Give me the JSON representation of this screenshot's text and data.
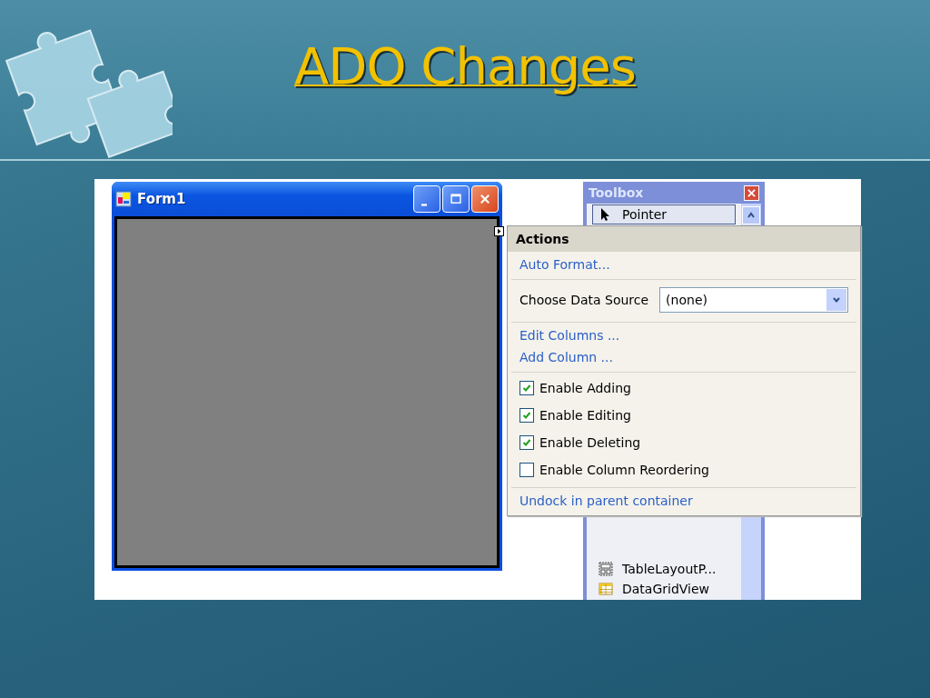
{
  "slide": {
    "title": "ADO Changes"
  },
  "form_window": {
    "title": "Form1"
  },
  "toolbox": {
    "title": "Toolbox",
    "items": [
      {
        "label": "Pointer",
        "kind": "pointer",
        "selected": true
      },
      {
        "label": "TableLayoutP...",
        "kind": "table-layout",
        "selected": false
      },
      {
        "label": "DataGridView",
        "kind": "grid",
        "selected": false
      }
    ]
  },
  "actions_panel": {
    "title": "Actions",
    "sections": [
      [
        {
          "kind": "link",
          "label": "Auto Format..."
        }
      ],
      [
        {
          "kind": "dropdown",
          "label": "Choose Data Source",
          "value": "(none)"
        }
      ],
      [
        {
          "kind": "link",
          "label": "Edit Columns ..."
        },
        {
          "kind": "link",
          "label": "Add Column ..."
        }
      ],
      [
        {
          "kind": "checkbox",
          "label": "Enable Adding",
          "checked": true
        },
        {
          "kind": "checkbox",
          "label": "Enable Editing",
          "checked": true
        },
        {
          "kind": "checkbox",
          "label": "Enable Deleting",
          "checked": true
        },
        {
          "kind": "checkbox",
          "label": "Enable Column Reordering",
          "checked": false
        }
      ],
      [
        {
          "kind": "link",
          "label": "Undock in parent container"
        }
      ]
    ]
  }
}
